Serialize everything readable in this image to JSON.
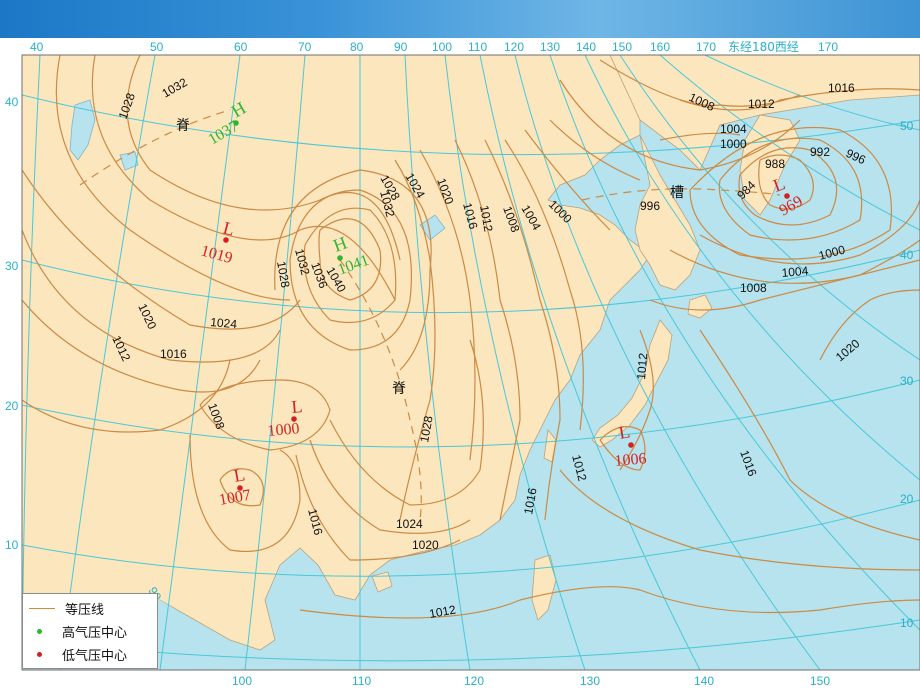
{
  "top_longitudes": [
    "40",
    "50",
    "60",
    "70",
    "80",
    "90",
    "100",
    "110",
    "120",
    "130",
    "140",
    "150",
    "160",
    "170",
    "东经180西经",
    "170"
  ],
  "bottom_longitudes": [
    "100",
    "110",
    "120",
    "130",
    "140",
    "150"
  ],
  "left_latitudes": [
    "40",
    "30",
    "20",
    "10"
  ],
  "right_latitudes": [
    "50",
    "40",
    "30",
    "20",
    "10"
  ],
  "inner_meridian_label": "90",
  "isobar_labels": [
    "1032",
    "1028",
    "1028",
    "1024",
    "1020",
    "1016",
    "1012",
    "1008",
    "1004",
    "1000",
    "1032",
    "1028",
    "1032",
    "1036",
    "1040",
    "1024",
    "1020",
    "1016",
    "1012",
    "1008",
    "1028",
    "1016",
    "1024",
    "1020",
    "1016",
    "1012",
    "1012",
    "1012",
    "1016",
    "1016",
    "1012",
    "1008",
    "1004",
    "1000",
    "988",
    "992",
    "996",
    "996",
    "984",
    "1000",
    "1004",
    "1008",
    "1020"
  ],
  "pressure_centers": {
    "high1": {
      "letter": "H",
      "value": "1037"
    },
    "high2": {
      "letter": "H",
      "value": "1041"
    },
    "low1": {
      "letter": "L",
      "value": "1019"
    },
    "low2": {
      "letter": "L",
      "value": "1000"
    },
    "low3": {
      "letter": "L",
      "value": "1007"
    },
    "low4": {
      "letter": "L",
      "value": "1006"
    },
    "low5": {
      "letter": "L",
      "value": "969"
    }
  },
  "features": {
    "ridge1": "脊",
    "ridge2": "脊",
    "trough": "槽"
  },
  "legend": {
    "isobar": "等压线",
    "high_center": "高气压中心",
    "low_center": "低气压中心"
  },
  "colors": {
    "land": "#fce6bd",
    "sea": "#b6e3ee",
    "isobar": "#cc8a44",
    "graticule": "#49c8d8",
    "high": "#2fb52f",
    "low": "#d42020",
    "banner": "#3a93d8"
  }
}
